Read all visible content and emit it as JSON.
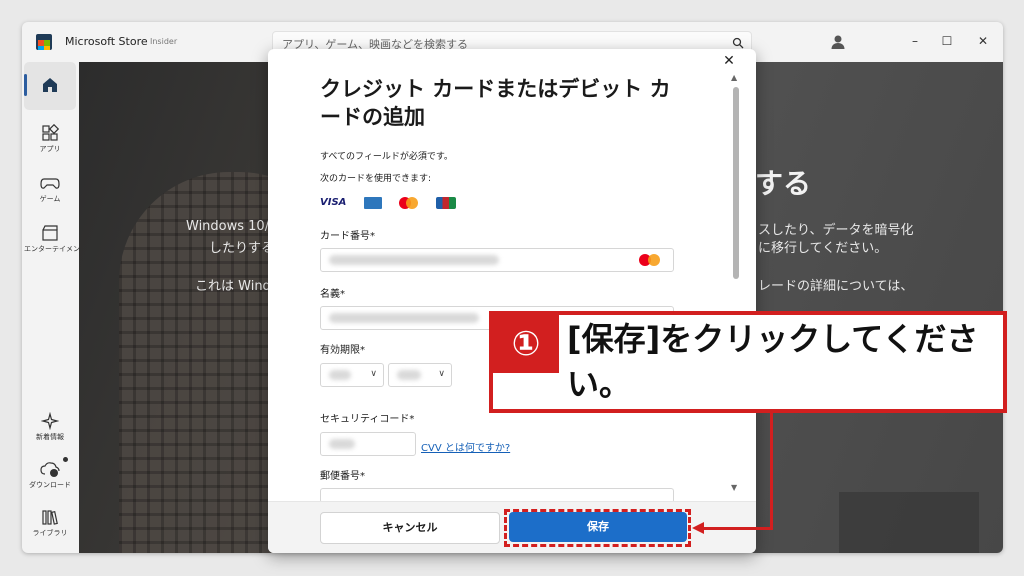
{
  "window": {
    "title": "Microsoft Store",
    "badge": "Insider",
    "search_placeholder": "アプリ、ゲーム、映画などを検索する",
    "controls": [
      "–",
      "☐",
      "✕"
    ]
  },
  "nav": {
    "items": [
      {
        "label": "",
        "icon": "home-icon"
      },
      {
        "label": "アプリ",
        "icon": "apps-icon"
      },
      {
        "label": "ゲーム",
        "icon": "gamepad-icon"
      },
      {
        "label": "エンターテイメント",
        "icon": "clapperboard-icon"
      },
      {
        "label": "新着情報",
        "icon": "sparkle-icon"
      },
      {
        "label": "ダウンロード",
        "icon": "download-cloud-icon"
      },
      {
        "label": "ライブラリ",
        "icon": "library-icon"
      }
    ]
  },
  "hero": {
    "big_text": "する",
    "line1": "Windows 10/",
    "line1_right": "スしたり、データを暗号化",
    "line2": "したりする",
    "line2_right": "に移行してください。",
    "line3": "これは Windo",
    "line3_right": "レードの詳細については、"
  },
  "dialog": {
    "title": "クレジット カードまたはデビット カードの追加",
    "required_note": "すべてのフィールドが必須です。",
    "accepted_cards_label": "次のカードを使用できます:",
    "cards": [
      "VISA",
      "American Express",
      "Mastercard",
      "JCB"
    ],
    "fields": {
      "card_number_label": "カード番号*",
      "name_label": "名義*",
      "expiry_label": "有効期限*",
      "security_code_label": "セキュリティコード*",
      "cvv_link": "CVV とは何ですか?",
      "postal_label": "郵便番号*"
    },
    "cancel_label": "キャンセル",
    "save_label": "保存"
  },
  "callout": {
    "number": "①",
    "text": "[保存]をクリックしてください。"
  },
  "colors": {
    "accent": "#1c6ec9",
    "annotation_red": "#d21f1f",
    "nav_indicator": "#2c5d9f"
  }
}
